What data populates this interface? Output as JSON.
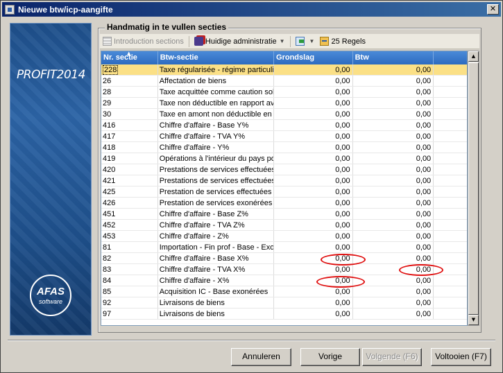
{
  "window": {
    "title": "Nieuwe btw/icp-aangifte",
    "close_glyph": "✕"
  },
  "sidebar": {
    "brand_main": "PROFIT",
    "brand_year": "2014",
    "logo_main": "AFAS",
    "logo_sub": "software"
  },
  "group_label": "Handmatig in te vullen secties",
  "toolbar": {
    "intro_label": "Introduction sections",
    "admin_label": "Huidige administratie",
    "rows_label": "25 Regels",
    "icons": [
      "intro-sections-icon",
      "administration-icon",
      "export-icon",
      "rows-count-icon"
    ]
  },
  "grid": {
    "columns": [
      "Nr. sectie",
      "Btw-sectie",
      "Grondslag",
      "Btw"
    ],
    "rows": [
      [
        "228",
        "Taxe régularisée - régime particulie",
        "0,00",
        "0,00"
      ],
      [
        "26",
        "Affectation de biens",
        "0,00",
        "0,00"
      ],
      [
        "28",
        "Taxe acquittée comme caution soli",
        "0,00",
        "0,00"
      ],
      [
        "29",
        "Taxe non déductible en rapport av",
        "0,00",
        "0,00"
      ],
      [
        "30",
        "Taxe en amont non déductible en a",
        "0,00",
        "0,00"
      ],
      [
        "416",
        "Chiffre d'affaire - Base Y%",
        "0,00",
        "0,00"
      ],
      [
        "417",
        "Chiffre d'affaire - TVA Y%",
        "0,00",
        "0,00"
      ],
      [
        "418",
        "Chiffre d'affaire - Y%",
        "0,00",
        "0,00"
      ],
      [
        "419",
        "Opérations à l'intérieur du pays pou",
        "0,00",
        "0,00"
      ],
      [
        "420",
        "Prestations de services effectuées",
        "0,00",
        "0,00"
      ],
      [
        "421",
        "Prestations de services effectuées",
        "0,00",
        "0,00"
      ],
      [
        "425",
        "Prestation de services effectuées d",
        "0,00",
        "0,00"
      ],
      [
        "426",
        "Prestation de services exonérées",
        "0,00",
        "0,00"
      ],
      [
        "451",
        "Chiffre d'affaire - Base Z%",
        "0,00",
        "0,00"
      ],
      [
        "452",
        "Chiffre d'affaire - TVA Z%",
        "0,00",
        "0,00"
      ],
      [
        "453",
        "Chiffre d'affaire - Z%",
        "0,00",
        "0,00"
      ],
      [
        "81",
        "Importation - Fin prof - Base - Exon",
        "0,00",
        "0,00"
      ],
      [
        "82",
        "Chiffre d'affaire - Base X%",
        "0,00",
        "0,00"
      ],
      [
        "83",
        "Chiffre d'affaire - TVA X%",
        "0,00",
        "0,00"
      ],
      [
        "84",
        "Chiffre d'affaire - X%",
        "0,00",
        "0,00"
      ],
      [
        "85",
        "Acquisition IC - Base exonérées",
        "0,00",
        "0,00"
      ],
      [
        "92",
        "Livraisons de biens",
        "0,00",
        "0,00"
      ],
      [
        "97",
        "Livraisons de biens",
        "0,00",
        "0,00"
      ]
    ]
  },
  "scrollbar": {
    "up_glyph": "▲",
    "down_glyph": "▼"
  },
  "buttons": {
    "cancel": "Annuleren",
    "previous": "Vorige",
    "next": "Volgende (F6)",
    "finish": "Voltooien (F7)"
  },
  "colors": {
    "selected_row": "#fbe086",
    "header": "#2d6bc0",
    "annotation": "#e01010"
  }
}
